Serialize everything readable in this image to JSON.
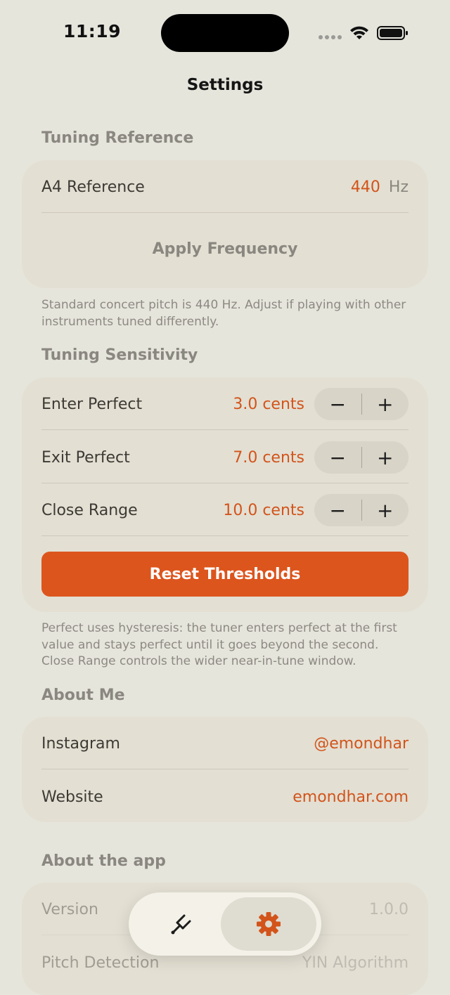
{
  "status_bar": {
    "time": "11:19"
  },
  "nav": {
    "title": "Settings"
  },
  "tuning_reference": {
    "header": "Tuning Reference",
    "a4_label": "A4 Reference",
    "a4_value": "440",
    "a4_unit": "Hz",
    "apply_label": "Apply Frequency",
    "footnote": "Standard concert pitch is 440 Hz. Adjust if playing with other instruments tuned differently."
  },
  "tuning_sensitivity": {
    "header": "Tuning Sensitivity",
    "rows": [
      {
        "label": "Enter Perfect",
        "value": "3.0 cents",
        "minus": "−",
        "plus": "+"
      },
      {
        "label": "Exit Perfect",
        "value": "7.0 cents",
        "minus": "−",
        "plus": "+"
      },
      {
        "label": "Close Range",
        "value": "10.0 cents",
        "minus": "−",
        "plus": "+"
      }
    ],
    "reset_label": "Reset Thresholds",
    "footnote": "Perfect uses hysteresis: the tuner enters perfect at the first value and stays perfect until it goes beyond the second. Close Range controls the wider near-in-tune window."
  },
  "about_me": {
    "header": "About Me",
    "rows": [
      {
        "label": "Instagram",
        "value": "@emondhar"
      },
      {
        "label": "Website",
        "value": "emondhar.com"
      }
    ]
  },
  "about_app": {
    "header": "About the app",
    "rows": [
      {
        "label": "Version",
        "value": "1.0.0"
      },
      {
        "label": "Pitch Detection",
        "value": "YIN Algorithm"
      }
    ]
  },
  "tab_bar": {
    "tabs": [
      {
        "icon": "tuning-fork-icon",
        "selected": false
      },
      {
        "icon": "gear-icon",
        "selected": true
      }
    ]
  },
  "colors": {
    "background": "#e6e5dc",
    "card": "#e3dfd3",
    "accent": "#dc551d",
    "value_text": "#d2541a",
    "secondary_text": "#8a8780"
  }
}
